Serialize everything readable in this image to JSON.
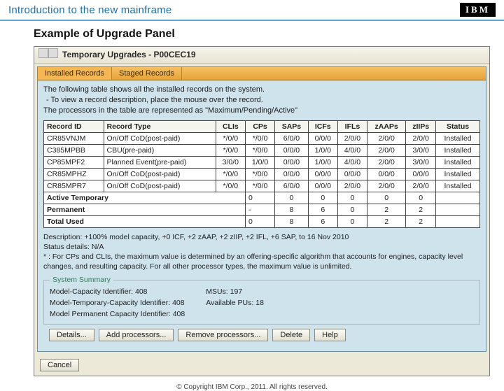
{
  "topbar": {
    "title": "Introduction to the new mainframe",
    "logo": "IBM"
  },
  "page_title": "Example of Upgrade Panel",
  "window_title": "Temporary Upgrades - P00CEC19",
  "tabs": {
    "installed": "Installed Records",
    "staged": "Staged Records"
  },
  "intro": {
    "line1": "The following table shows all the installed records on the system.",
    "line2": "- To view a record description, place the mouse over the record.",
    "line3": "The processors in the table are represented as \"Maximum/Pending/Active\""
  },
  "headers": [
    "Record ID",
    "Record Type",
    "CLIs",
    "CPs",
    "SAPs",
    "ICFs",
    "IFLs",
    "zAAPs",
    "zIIPs",
    "Status"
  ],
  "rows": [
    [
      "CR85VNJM",
      "On/Off CoD(post-paid)",
      "*/0/0",
      "*/0/0",
      "6/0/0",
      "0/0/0",
      "2/0/0",
      "2/0/0",
      "2/0/0",
      "Installed"
    ],
    [
      "C385MPBB",
      "CBU(pre-paid)",
      "*/0/0",
      "*/0/0",
      "0/0/0",
      "1/0/0",
      "4/0/0",
      "2/0/0",
      "3/0/0",
      "Installed"
    ],
    [
      "CP85MPF2",
      "Planned Event(pre-paid)",
      "3/0/0",
      "1/0/0",
      "0/0/0",
      "1/0/0",
      "4/0/0",
      "2/0/0",
      "3/0/0",
      "Installed"
    ],
    [
      "CR85MPHZ",
      "On/Off CoD(post-paid)",
      "*/0/0",
      "*/0/0",
      "0/0/0",
      "0/0/0",
      "0/0/0",
      "0/0/0",
      "0/0/0",
      "Installed"
    ],
    [
      "CR85MPR7",
      "On/Off CoD(post-paid)",
      "*/0/0",
      "*/0/0",
      "6/0/0",
      "0/0/0",
      "2/0/0",
      "2/0/0",
      "2/0/0",
      "Installed"
    ]
  ],
  "summary": [
    [
      "Active Temporary",
      "0",
      "0",
      "0",
      "0",
      "0",
      "0"
    ],
    [
      "Permanent",
      "-",
      "8",
      "6",
      "0",
      "2",
      "2"
    ],
    [
      "Total Used",
      "0",
      "8",
      "6",
      "0",
      "2",
      "2"
    ]
  ],
  "desc": {
    "d1": "Description: +100% model capacity, +0 ICF, +2 zAAP, +2 zIIP, +2 IFL, +6 SAP, to 16 Nov 2010",
    "d2": "Status details: N/A",
    "d3": "* : For CPs and CLIs, the maximum value is determined by an offering-specific algorithm that accounts for engines, capacity level changes, and resulting capacity. For all other processor types, the maximum value is unlimited."
  },
  "sys": {
    "legend": "System Summary",
    "l1": "Model-Capacity Identifier:",
    "l1v": "408",
    "l2": "Model-Temporary-Capacity Identifier:",
    "l2v": "408",
    "l3": "Model Permanent Capacity Identifier:",
    "l3v": "408",
    "r1": "MSUs:",
    "r1v": "197",
    "r2": "Available PUs:",
    "r2v": "18"
  },
  "buttons": {
    "details": "Details...",
    "addproc": "Add processors...",
    "removeproc": "Remove processors...",
    "delete": "Delete",
    "help": "Help",
    "cancel": "Cancel"
  },
  "copyright": "© Copyright IBM Corp., 2011. All rights reserved."
}
